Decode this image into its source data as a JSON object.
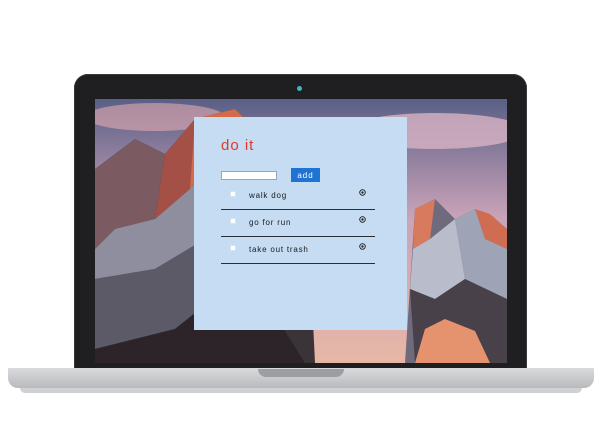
{
  "app": {
    "title": "do it",
    "input_value": "",
    "add_label": "add",
    "tasks": [
      {
        "label": "walk dog",
        "done": false,
        "delete_icon": "remove-circle-icon"
      },
      {
        "label": "go for run",
        "done": false,
        "delete_icon": "remove-circle-icon"
      },
      {
        "label": "take out trash",
        "done": false,
        "delete_icon": "remove-circle-icon"
      }
    ]
  },
  "colors": {
    "title": "#e0392b",
    "panel": "#c5dcf3",
    "button": "#1f73d2"
  }
}
